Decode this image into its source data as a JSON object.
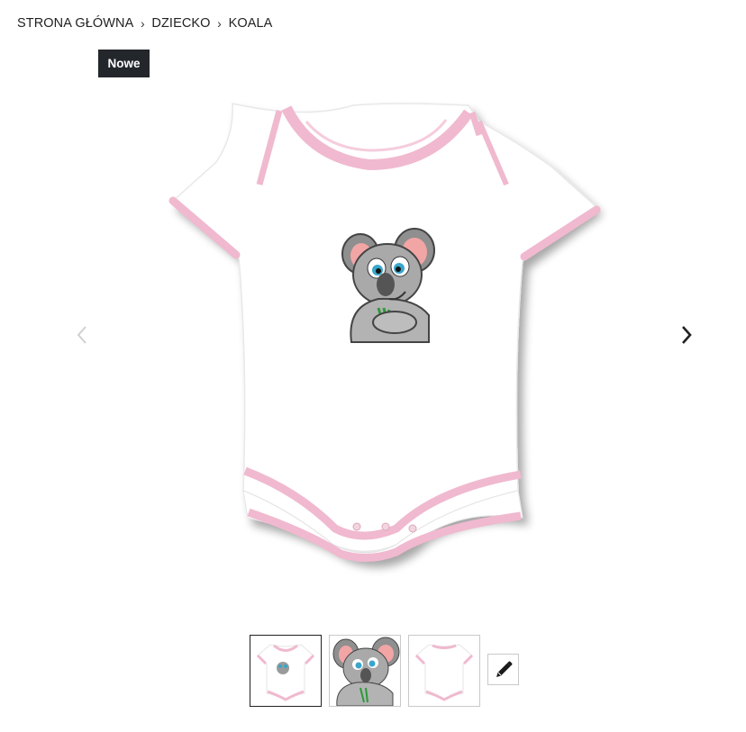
{
  "breadcrumb": {
    "home": "STRONA GŁÓWNA",
    "category": "DZIECKO",
    "current": "KOALA",
    "separator": "›"
  },
  "badge": {
    "label": "Nowe"
  },
  "gallery": {
    "prev_icon": "chevron-left-icon",
    "next_icon": "chevron-right-icon",
    "thumbnails": [
      {
        "name": "thumb-bodysuit-front",
        "active": true
      },
      {
        "name": "thumb-koala-design",
        "active": false
      },
      {
        "name": "thumb-bodysuit-back",
        "active": false
      }
    ],
    "edit_icon": "pencil-icon"
  },
  "colors": {
    "trim_pink": "#f0b9cf",
    "badge_bg": "#23272b",
    "koala_gray": "#9a9a9a",
    "eye_blue": "#3aa6c9"
  }
}
